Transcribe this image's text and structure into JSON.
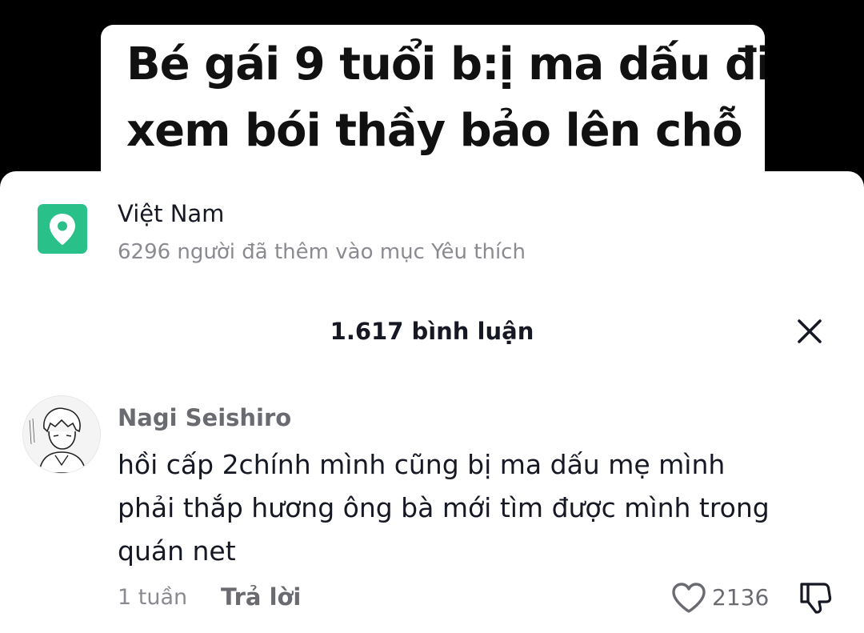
{
  "video_caption": {
    "lines": [
      "Bé gái 9 tuổi b:ị ma dấu đi",
      "xem bói thầy bảo lên chỗ"
    ]
  },
  "location": {
    "title": "Việt Nam",
    "subtitle": "6296 người đã thêm vào mục Yêu thích",
    "icon": "location-pin-icon",
    "color": "#29c08a"
  },
  "comments_header": {
    "count_label": "1.617 bình luận",
    "close_icon": "close-icon"
  },
  "comment": {
    "author": "Nagi Seishiro",
    "text_lines": [
      "hồi cấp 2chính mình cũng bị ma dấu mẹ mình",
      "phải thắp hương ông bà mới tìm được mình trong",
      "quán net"
    ],
    "time": "1 tuần",
    "reply_label": "Trả lời",
    "like_count": "2136",
    "icons": [
      "heart-icon",
      "dislike-icon"
    ]
  }
}
